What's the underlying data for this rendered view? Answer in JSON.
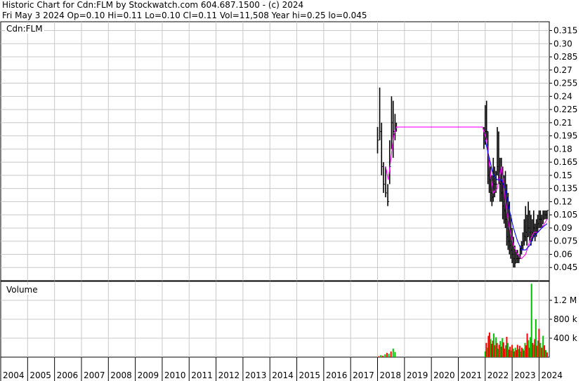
{
  "header": {
    "line1": "Historic Chart for Cdn:FLM by Stockwatch.com 604.687.1500 - (c) 2024",
    "line2": "Fri May  3 2024  Op=0.10  Hi=0.11  Lo=0.10  Cl=0.11  Vol=11,508  Year hi=0.25  lo=0.045"
  },
  "chart_data": [
    {
      "type": "line",
      "panel_label": "Cdn:FLM",
      "ylim": [
        0.03,
        0.325
      ],
      "y_ticks": [
        "0.315",
        "0.30",
        "0.285",
        "0.27",
        "0.255",
        "0.24",
        "0.225",
        "0.21",
        "0.195",
        "0.18",
        "0.165",
        "0.15",
        "0.135",
        "0.12",
        "0.105",
        "0.09",
        "0.075",
        "0.06",
        "0.045"
      ],
      "x_ticks": [
        "2004",
        "2005",
        "2006",
        "2007",
        "2008",
        "2009",
        "2010",
        "2011",
        "2012",
        "2013",
        "2014",
        "2015",
        "2016",
        "2017",
        "2018",
        "2019",
        "2020",
        "2021",
        "2022",
        "2023",
        "2024"
      ],
      "grid": true,
      "price_series": {
        "name": "",
        "x": [
          2018.0,
          2018.08,
          2018.15,
          2018.22,
          2018.3,
          2018.38,
          2018.45,
          2018.52,
          2018.58,
          2018.65,
          2018.7,
          2021.95,
          2022.0,
          2022.05,
          2022.1,
          2022.15,
          2022.2,
          2022.25,
          2022.3,
          2022.35,
          2022.4,
          2022.45,
          2022.5,
          2022.55,
          2022.6,
          2022.65,
          2022.7,
          2022.75,
          2022.8,
          2022.85,
          2022.9,
          2022.95,
          2023.0,
          2023.05,
          2023.1,
          2023.15,
          2023.2,
          2023.25,
          2023.3,
          2023.35,
          2023.4,
          2023.45,
          2023.5,
          2023.55,
          2023.6,
          2023.65,
          2023.7,
          2023.75,
          2023.8,
          2023.85,
          2023.9,
          2023.95,
          2024.0,
          2024.05,
          2024.1,
          2024.15,
          2024.2,
          2024.25,
          2024.3
        ],
        "high": [
          0.205,
          0.25,
          0.21,
          0.165,
          0.16,
          0.14,
          0.19,
          0.24,
          0.235,
          0.22,
          0.21,
          0.205,
          0.23,
          0.235,
          0.2,
          0.17,
          0.16,
          0.15,
          0.17,
          0.16,
          0.155,
          0.205,
          0.2,
          0.17,
          0.17,
          0.16,
          0.15,
          0.155,
          0.14,
          0.13,
          0.12,
          0.105,
          0.09,
          0.08,
          0.07,
          0.065,
          0.065,
          0.06,
          0.07,
          0.075,
          0.085,
          0.1,
          0.115,
          0.105,
          0.12,
          0.11,
          0.105,
          0.1,
          0.11,
          0.095,
          0.1,
          0.105,
          0.11,
          0.11,
          0.105,
          0.11,
          0.11,
          0.11,
          0.11
        ],
        "low": [
          0.175,
          0.19,
          0.15,
          0.13,
          0.125,
          0.115,
          0.14,
          0.18,
          0.17,
          0.19,
          0.2,
          0.18,
          0.185,
          0.19,
          0.14,
          0.13,
          0.12,
          0.115,
          0.12,
          0.125,
          0.13,
          0.15,
          0.14,
          0.12,
          0.12,
          0.1,
          0.095,
          0.09,
          0.07,
          0.065,
          0.06,
          0.055,
          0.05,
          0.045,
          0.045,
          0.05,
          0.05,
          0.05,
          0.055,
          0.06,
          0.065,
          0.07,
          0.075,
          0.07,
          0.08,
          0.075,
          0.07,
          0.075,
          0.08,
          0.075,
          0.08,
          0.085,
          0.09,
          0.09,
          0.09,
          0.095,
          0.1,
          0.1,
          0.1
        ],
        "close": [
          0.19,
          0.2,
          0.16,
          0.14,
          0.13,
          0.12,
          0.16,
          0.21,
          0.2,
          0.2,
          0.205,
          0.195,
          0.2,
          0.2,
          0.15,
          0.145,
          0.13,
          0.125,
          0.14,
          0.14,
          0.14,
          0.16,
          0.15,
          0.14,
          0.13,
          0.115,
          0.11,
          0.1,
          0.08,
          0.075,
          0.07,
          0.065,
          0.06,
          0.055,
          0.05,
          0.055,
          0.055,
          0.055,
          0.065,
          0.07,
          0.075,
          0.08,
          0.085,
          0.08,
          0.09,
          0.085,
          0.08,
          0.085,
          0.09,
          0.085,
          0.09,
          0.095,
          0.1,
          0.1,
          0.095,
          0.1,
          0.105,
          0.105,
          0.11
        ]
      },
      "ma_short": {
        "name": "",
        "color": "#ff00ff",
        "x": [
          2018.3,
          2018.4,
          2018.5,
          2018.6,
          2018.7,
          2021.9,
          2022.05,
          2022.2,
          2022.3,
          2022.45,
          2022.6,
          2022.75,
          2022.9,
          2023.05,
          2023.2,
          2023.35,
          2023.5,
          2023.65,
          2023.8,
          2023.95,
          2024.1,
          2024.3
        ],
        "y": [
          0.16,
          0.145,
          0.17,
          0.195,
          0.205,
          0.205,
          0.19,
          0.15,
          0.13,
          0.135,
          0.16,
          0.12,
          0.09,
          0.07,
          0.06,
          0.055,
          0.06,
          0.075,
          0.085,
          0.085,
          0.09,
          0.1
        ]
      },
      "ma_long": {
        "name": "",
        "color": "#0000ff",
        "x": [
          2022.0,
          2022.15,
          2022.3,
          2022.45,
          2022.6,
          2022.75,
          2022.9,
          2023.05,
          2023.2,
          2023.35,
          2023.5,
          2023.65,
          2023.8,
          2023.95,
          2024.1,
          2024.3
        ],
        "y": [
          0.19,
          0.17,
          0.15,
          0.145,
          0.145,
          0.135,
          0.11,
          0.09,
          0.075,
          0.065,
          0.065,
          0.07,
          0.08,
          0.085,
          0.09,
          0.095
        ]
      }
    },
    {
      "type": "bar",
      "panel_label": "Volume",
      "ylim": [
        0,
        1600000
      ],
      "y_ticks": [
        "1.2 M",
        "800 k",
        "400 k"
      ],
      "y_tick_values": [
        1200000,
        800000,
        400000
      ],
      "grid": true,
      "x": [
        2018.05,
        2018.12,
        2018.2,
        2018.28,
        2018.35,
        2018.42,
        2018.5,
        2018.58,
        2018.65,
        2022.0,
        2022.04,
        2022.08,
        2022.12,
        2022.16,
        2022.2,
        2022.24,
        2022.28,
        2022.32,
        2022.36,
        2022.4,
        2022.44,
        2022.48,
        2022.52,
        2022.56,
        2022.6,
        2022.64,
        2022.68,
        2022.72,
        2022.76,
        2022.8,
        2022.84,
        2022.88,
        2022.92,
        2022.96,
        2023.0,
        2023.04,
        2023.08,
        2023.12,
        2023.16,
        2023.2,
        2023.24,
        2023.28,
        2023.32,
        2023.36,
        2023.4,
        2023.44,
        2023.48,
        2023.52,
        2023.56,
        2023.6,
        2023.64,
        2023.68,
        2023.72,
        2023.76,
        2023.8,
        2023.84,
        2023.88,
        2023.92,
        2023.96,
        2024.0,
        2024.05,
        2024.1,
        2024.15,
        2024.2,
        2024.25,
        2024.3
      ],
      "values": [
        20000,
        40000,
        30000,
        60000,
        90000,
        70000,
        120000,
        180000,
        110000,
        120000,
        300000,
        200000,
        450000,
        520000,
        380000,
        280000,
        350000,
        500000,
        250000,
        420000,
        300000,
        180000,
        260000,
        340000,
        220000,
        400000,
        310000,
        180000,
        250000,
        430000,
        300000,
        160000,
        220000,
        140000,
        260000,
        180000,
        120000,
        200000,
        150000,
        260000,
        170000,
        240000,
        120000,
        200000,
        180000,
        140000,
        300000,
        250000,
        500000,
        360000,
        200000,
        420000,
        1550000,
        300000,
        260000,
        380000,
        800000,
        240000,
        350000,
        600000,
        300000,
        200000,
        450000,
        250000,
        150000,
        100000
      ],
      "colors": [
        "#ff0000",
        "#00c000",
        "#ff0000",
        "#00c000",
        "#ff0000",
        "#00c000",
        "#ff0000",
        "#00c000",
        "#00c000",
        "#00c000",
        "#ff0000",
        "#00c000",
        "#ff0000",
        "#ff0000",
        "#00c000",
        "#ff0000",
        "#ff0000",
        "#00c000",
        "#ff0000",
        "#00c000",
        "#ff0000",
        "#00c000",
        "#ff0000",
        "#00c000",
        "#ff0000",
        "#00c000",
        "#ff0000",
        "#ff0000",
        "#00c000",
        "#ff0000",
        "#00c000",
        "#ff0000",
        "#ff0000",
        "#00c000",
        "#ff0000",
        "#00c000",
        "#ff0000",
        "#00c000",
        "#ff0000",
        "#ff0000",
        "#00c000",
        "#ff0000",
        "#00c000",
        "#ff0000",
        "#00c000",
        "#ff0000",
        "#00c000",
        "#ff0000",
        "#ff0000",
        "#00c000",
        "#ff0000",
        "#00c000",
        "#00c000",
        "#ff0000",
        "#00c000",
        "#ff0000",
        "#00c000",
        "#ff0000",
        "#00c000",
        "#ff0000",
        "#00c000",
        "#ff0000",
        "#00c000",
        "#ff0000",
        "#00c000",
        "#ff0000"
      ]
    }
  ],
  "colors": {
    "grid": "#c8c8c8",
    "price_bar": "#000000",
    "volume_up": "#00c000",
    "volume_down": "#ff0000",
    "frame": "#000000"
  }
}
